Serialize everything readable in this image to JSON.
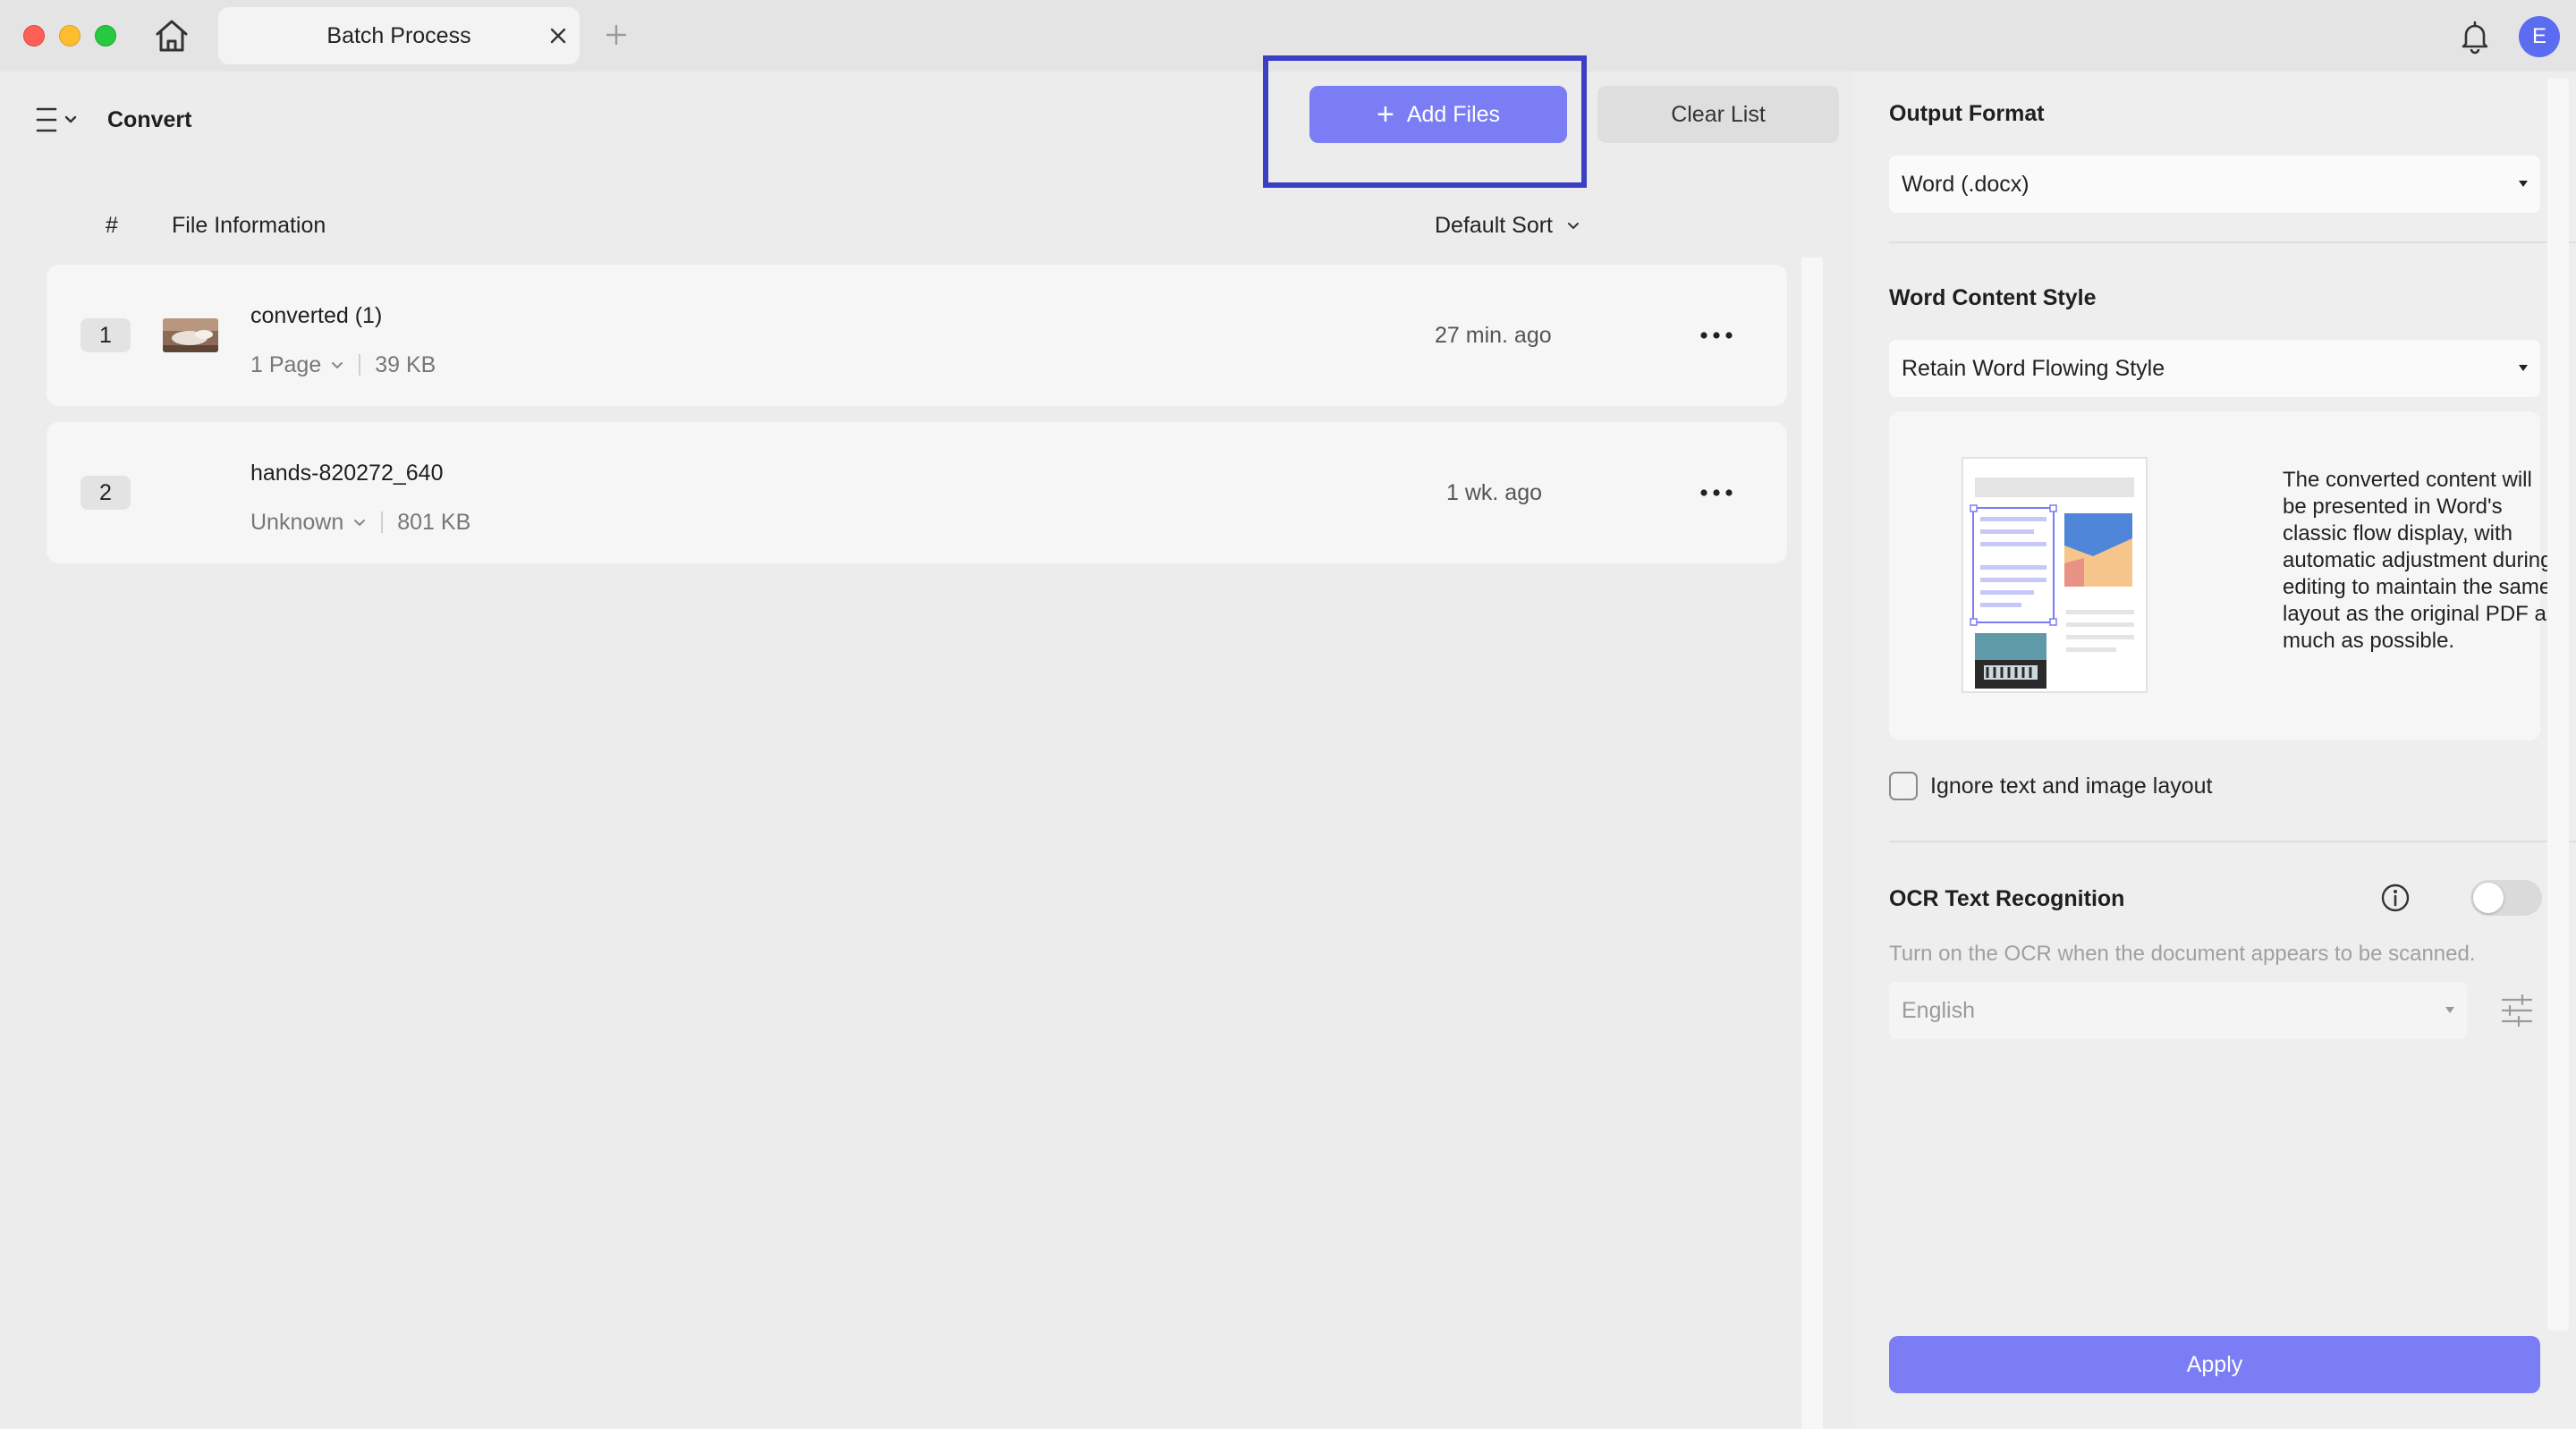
{
  "window": {
    "tab_title": "Batch Process",
    "avatar_initial": "E"
  },
  "toolbar": {
    "mode_label": "Convert",
    "add_files_label": "Add Files",
    "clear_list_label": "Clear List"
  },
  "list_header": {
    "index_label": "#",
    "info_label": "File Information",
    "sort_label": "Default Sort"
  },
  "files": [
    {
      "index": "1",
      "name": "converted (1)",
      "pages": "1 Page",
      "size": "39 KB",
      "modified": "27 min. ago",
      "has_thumbnail": true
    },
    {
      "index": "2",
      "name": "hands-820272_640",
      "pages": "Unknown",
      "size": "801 KB",
      "modified": "1 wk. ago",
      "has_thumbnail": false
    }
  ],
  "settings": {
    "output_format_title": "Output Format",
    "output_format_value": "Word (.docx)",
    "content_style_title": "Word Content Style",
    "content_style_value": "Retain Word Flowing Style",
    "content_style_description": "The converted content will be presented in Word's classic flow display, with automatic adjustment during editing to maintain the same layout as the original PDF as much as possible.",
    "ignore_layout_label": "Ignore text and image layout",
    "ignore_layout_checked": false,
    "ocr_title": "OCR Text Recognition",
    "ocr_enabled": false,
    "ocr_hint": "Turn on the OCR when the document appears to be scanned.",
    "ocr_language": "English",
    "apply_label": "Apply"
  },
  "colors": {
    "accent": "#7b7df4",
    "highlight_border": "#3b3fc4",
    "avatar": "#5b6cf0"
  }
}
